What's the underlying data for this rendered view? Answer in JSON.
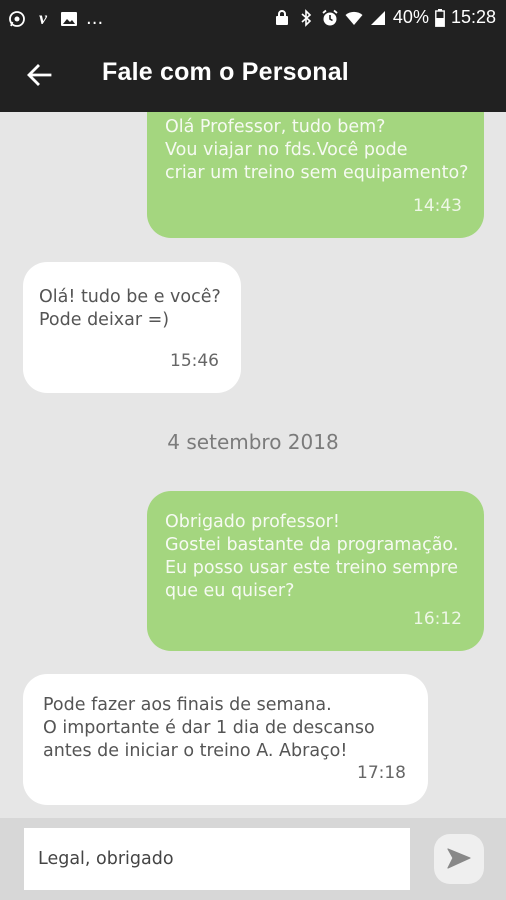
{
  "status_bar": {
    "left_icons": [
      "whatsapp-icon",
      "vimeo-icon",
      "image-icon"
    ],
    "overflow": "...",
    "battery": "40%",
    "time": "15:28"
  },
  "header": {
    "title": "Fale com o Personal"
  },
  "messages": [
    {
      "direction": "out",
      "text": "Olá Professor, tudo bem?\nVou viajar no fds.Você pode\ncriar um treino sem equipamento?",
      "time": "14:43"
    },
    {
      "direction": "in",
      "text": "Olá! tudo be e você?\nPode deixar =)",
      "time": "15:46"
    },
    {
      "type": "date",
      "text": "4 setembro 2018"
    },
    {
      "direction": "out",
      "text": "Obrigado professor!\nGostei bastante da programação.\nEu posso usar este treino sempre\nque eu quiser?",
      "time": "16:12"
    },
    {
      "direction": "in",
      "text": "Pode fazer aos finais de semana.\nO importante é dar 1 dia de descanso\nantes de iniciar o treino A. Abraço!",
      "time": "17:18"
    }
  ],
  "composer": {
    "value": "Legal, obrigado"
  },
  "colors": {
    "bar": "#212121",
    "outgoing": "#a4d67f",
    "incoming": "#ffffff",
    "background": "#e6e6e6"
  }
}
